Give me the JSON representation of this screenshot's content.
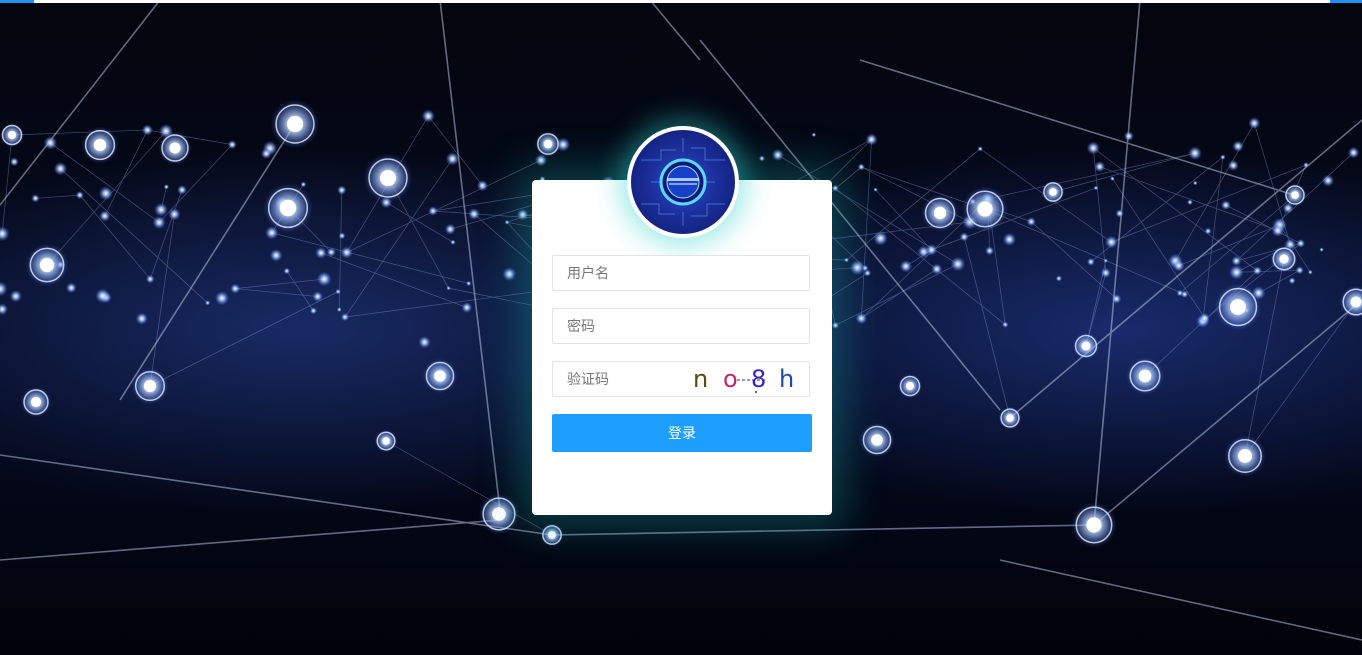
{
  "login_form": {
    "username_placeholder": "用户名",
    "password_placeholder": "密码",
    "captcha_placeholder": "验证码",
    "captcha_chars": [
      {
        "char": "n",
        "color": "#5a4a10"
      },
      {
        "char": "o",
        "color": "#c0246a"
      },
      {
        "char": "8",
        "color": "#3a23c8"
      },
      {
        "char": "h",
        "color": "#1e4aa8"
      }
    ],
    "submit_label": "登录"
  },
  "colors": {
    "accent": "#1e9fff",
    "top_line_accent": "#1e90ff",
    "card_glow": "#1ec8be"
  },
  "icons": {
    "logo": "circuit-badge-logo"
  }
}
